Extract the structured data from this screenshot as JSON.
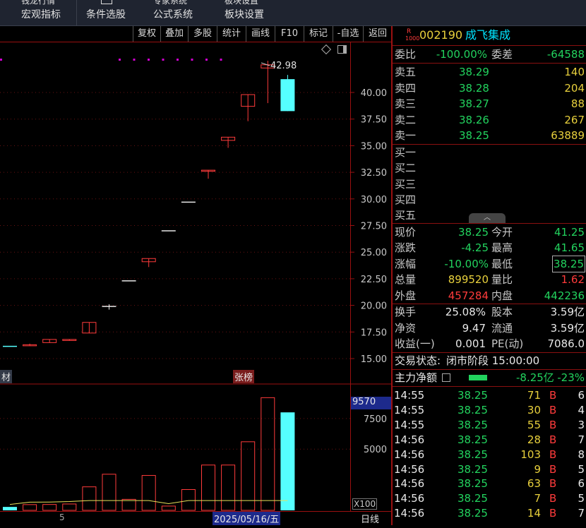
{
  "topbar": {
    "menus": [
      {
        "label": "宏观指标",
        "partial": "钱龙行情"
      },
      {
        "label": "条件选股",
        "partial": ""
      },
      {
        "label": "公式系统",
        "partial": "专家系统"
      },
      {
        "label": "板块设置",
        "partial": "板块设置"
      }
    ]
  },
  "toolbar": {
    "buttons": [
      "复权",
      "叠加",
      "多股",
      "统计",
      "画线",
      "F10",
      "标记",
      "-自选",
      "返回"
    ]
  },
  "chart": {
    "price_ticks": [
      "40.00",
      "37.50",
      "35.00",
      "32.50",
      "30.00",
      "27.50",
      "25.00",
      "22.50",
      "20.00",
      "17.50",
      "15.00"
    ],
    "high_label": "42.98",
    "left_tag": "材",
    "zhangbang_tag": "张榜",
    "volume_readout": "9570",
    "volume_ticks": [
      "7500",
      "5000"
    ],
    "volume_unit": "X100",
    "date_label": "2025/05/16/五",
    "period_label": "日线",
    "bottom_tick": "5",
    "colors": {
      "up": "#ff3b3b",
      "down": "#55ffff",
      "ma": "#e8e25a",
      "dots": "#d000d0"
    }
  },
  "chart_data": {
    "type": "candlestick",
    "candles": [
      {
        "o": 16.2,
        "c": 16.2,
        "h": 16.2,
        "l": 16.2,
        "dir": "down"
      },
      {
        "o": 16.3,
        "c": 16.3,
        "h": 16.4,
        "l": 16.2,
        "dir": "up"
      },
      {
        "o": 16.5,
        "c": 16.8,
        "h": 16.8,
        "l": 16.5,
        "dir": "up"
      },
      {
        "o": 16.7,
        "c": 16.8,
        "h": 16.8,
        "l": 16.7,
        "dir": "up"
      },
      {
        "o": 17.4,
        "c": 18.4,
        "h": 18.4,
        "l": 17.4,
        "dir": "up"
      },
      {
        "o": 19.9,
        "c": 19.9,
        "h": 20.1,
        "l": 19.6,
        "dir": "flat"
      },
      {
        "o": 22.3,
        "c": 22.3,
        "h": 22.3,
        "l": 22.3,
        "dir": "flat"
      },
      {
        "o": 24.1,
        "c": 24.4,
        "h": 24.4,
        "l": 23.6,
        "dir": "up"
      },
      {
        "o": 27.0,
        "c": 27.0,
        "h": 27.0,
        "l": 27.0,
        "dir": "flat"
      },
      {
        "o": 29.7,
        "c": 29.7,
        "h": 29.7,
        "l": 29.7,
        "dir": "flat"
      },
      {
        "o": 32.6,
        "c": 32.7,
        "h": 32.7,
        "l": 31.9,
        "dir": "up"
      },
      {
        "o": 35.5,
        "c": 35.8,
        "h": 35.8,
        "l": 34.8,
        "dir": "up"
      },
      {
        "o": 38.7,
        "c": 39.8,
        "h": 39.8,
        "l": 37.3,
        "dir": "up"
      },
      {
        "o": 42.3,
        "c": 42.6,
        "h": 42.98,
        "l": 39.0,
        "dir": "up"
      },
      {
        "o": 41.25,
        "c": 38.25,
        "h": 41.65,
        "l": 38.25,
        "dir": "down"
      }
    ],
    "volumes": [
      280,
      470,
      480,
      520,
      1920,
      2950,
      900,
      2850,
      350,
      1700,
      3700,
      3700,
      5600,
      9200,
      8000
    ],
    "ylim": [
      14.0,
      44.0
    ],
    "vol_ylim": [
      0,
      10200
    ]
  },
  "quote": {
    "code": "002190",
    "name": "成飞集成",
    "badge_top": "R",
    "badge_bottom": "1000",
    "weibi_label": "委比",
    "weibi": "-100.00%",
    "weicha_label": "委差",
    "weicha": "-64588",
    "asks": [
      {
        "label": "卖五",
        "price": "38.29",
        "vol": "140"
      },
      {
        "label": "卖四",
        "price": "38.28",
        "vol": "204"
      },
      {
        "label": "卖三",
        "price": "38.27",
        "vol": "88"
      },
      {
        "label": "卖二",
        "price": "38.26",
        "vol": "267"
      },
      {
        "label": "卖一",
        "price": "38.25",
        "vol": "63889"
      }
    ],
    "bids": [
      {
        "label": "买一"
      },
      {
        "label": "买二"
      },
      {
        "label": "买三"
      },
      {
        "label": "买四"
      },
      {
        "label": "买五"
      }
    ],
    "stats1": [
      {
        "l1": "现价",
        "v1": "38.25",
        "l2": "今开",
        "v2": "41.25"
      },
      {
        "l1": "涨跌",
        "v1": "-4.25",
        "l2": "最高",
        "v2": "41.65"
      },
      {
        "l1": "涨幅",
        "v1": "-10.00%",
        "l2": "最低",
        "v2": "38.25"
      },
      {
        "l1": "总量",
        "v1": "899520",
        "l2": "量比",
        "v2": "1.62"
      },
      {
        "l1": "外盘",
        "v1": "457284",
        "l2": "内盘",
        "v2": "442236"
      }
    ],
    "stats2": [
      {
        "l1": "换手",
        "v1": "25.08%",
        "l2": "股本",
        "v2": "3.59亿"
      },
      {
        "l1": "净资",
        "v1": "9.47",
        "l2": "流通",
        "v2": "3.59亿"
      },
      {
        "l1": "收益(一)",
        "v1": "0.001",
        "l2": "PE(动)",
        "v2": "7086.0"
      }
    ],
    "trade_status_label": "交易状态:",
    "trade_status": "闭市阶段 15:00:00",
    "main_net_label": "主力净额",
    "main_net": "-8.25亿",
    "main_net_pct": "-23%"
  },
  "ticks": [
    {
      "t": "14:55",
      "p": "38.25",
      "v": "71",
      "bs": "B",
      "n": "6"
    },
    {
      "t": "14:55",
      "p": "38.25",
      "v": "30",
      "bs": "B",
      "n": "4"
    },
    {
      "t": "14:55",
      "p": "38.25",
      "v": "55",
      "bs": "B",
      "n": "3"
    },
    {
      "t": "14:56",
      "p": "38.25",
      "v": "28",
      "bs": "B",
      "n": "7"
    },
    {
      "t": "14:56",
      "p": "38.25",
      "v": "103",
      "bs": "B",
      "n": "8"
    },
    {
      "t": "14:56",
      "p": "38.25",
      "v": "9",
      "bs": "B",
      "n": "5"
    },
    {
      "t": "14:56",
      "p": "38.25",
      "v": "63",
      "bs": "B",
      "n": "6"
    },
    {
      "t": "14:56",
      "p": "38.25",
      "v": "7",
      "bs": "B",
      "n": "5"
    },
    {
      "t": "14:56",
      "p": "38.25",
      "v": "14",
      "bs": "B",
      "n": "7"
    }
  ]
}
